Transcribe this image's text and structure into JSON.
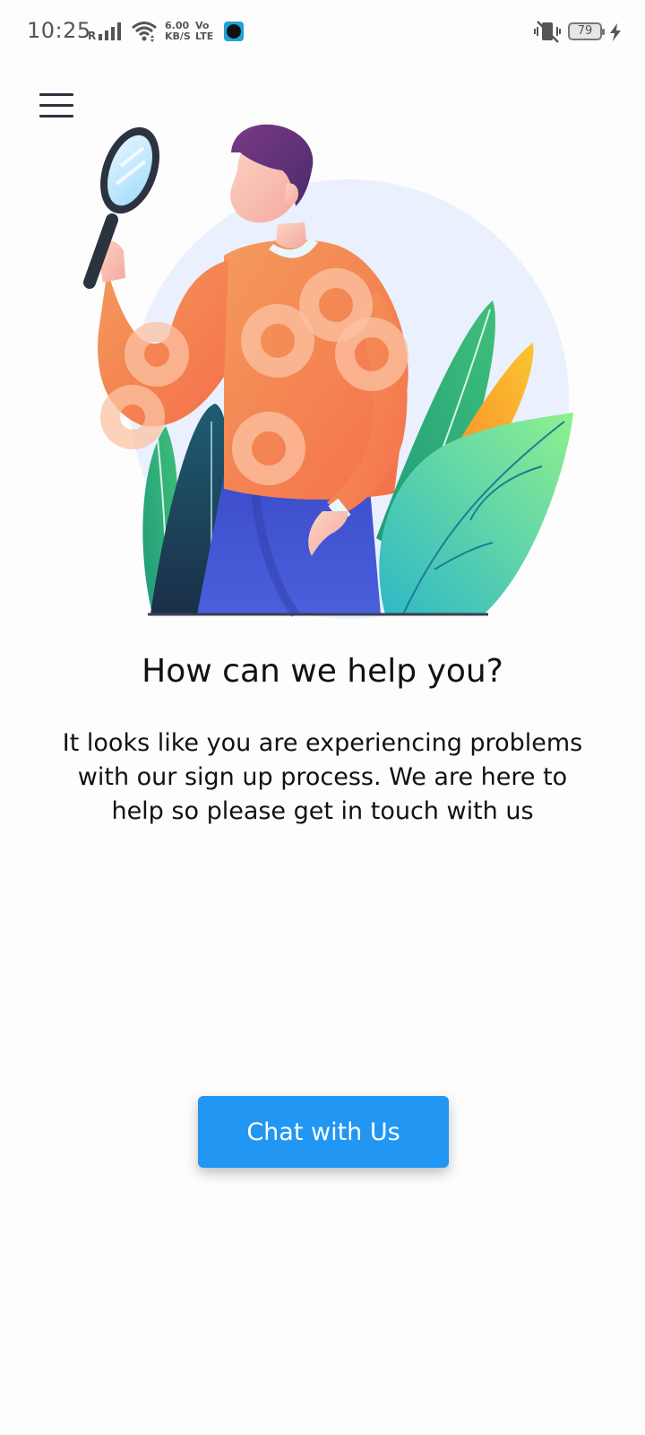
{
  "status_bar": {
    "time": "10:25",
    "signal_label": "R",
    "net_speed_value": "6.00",
    "net_speed_unit": "KB/S",
    "volte_top": "Vo",
    "volte_bottom": "LTE",
    "battery_level": "79",
    "icons": [
      "signal-icon",
      "wifi-icon",
      "app-notification-icon",
      "vibrate-mute-icon",
      "battery-icon",
      "charging-icon"
    ]
  },
  "header": {
    "menu_icon": "hamburger-menu-icon"
  },
  "illustration": {
    "icon": "help-search-illustration"
  },
  "main": {
    "title": "How can we help you?",
    "message": "It looks like you are experiencing problems with our sign up process. We are here to help so please get in touch with us",
    "chat_button_label": "Chat with Us"
  },
  "colors": {
    "primary": "#2196f3",
    "text": "#111111",
    "background": "#fdfdfd"
  }
}
